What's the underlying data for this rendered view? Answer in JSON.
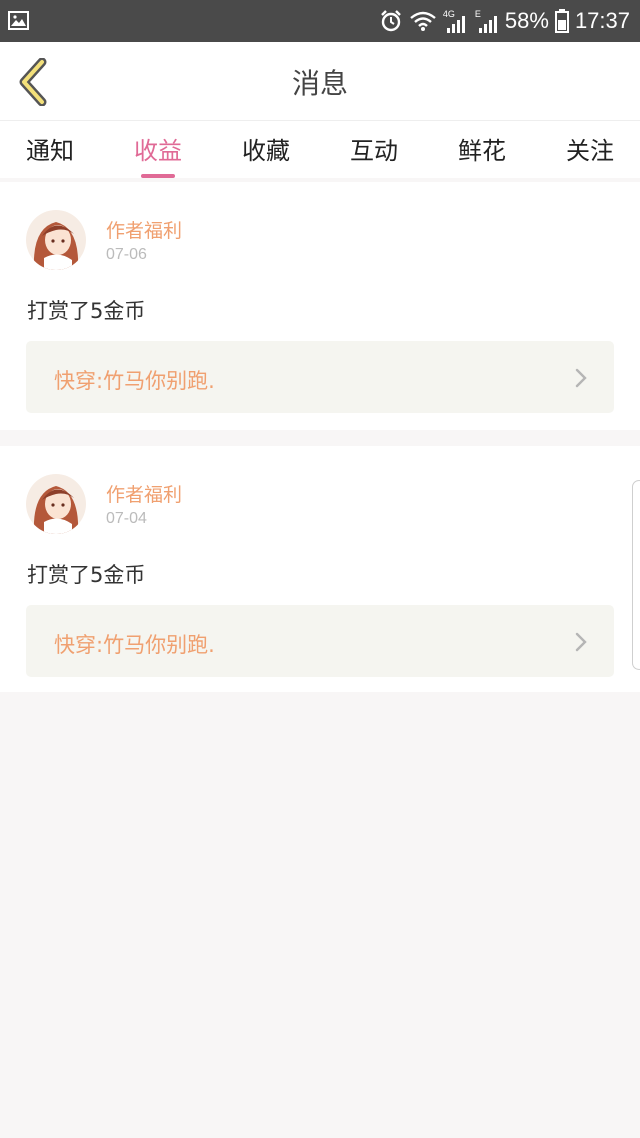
{
  "status_bar": {
    "network_label": "4G",
    "network_label_2": "E",
    "battery": "58%",
    "time": "17:37"
  },
  "header": {
    "title": "消息"
  },
  "tabs": [
    {
      "label": "通知",
      "active": false
    },
    {
      "label": "收益",
      "active": true
    },
    {
      "label": "收藏",
      "active": false
    },
    {
      "label": "互动",
      "active": false
    },
    {
      "label": "鲜花",
      "active": false
    },
    {
      "label": "关注",
      "active": false
    }
  ],
  "messages": [
    {
      "author": "作者福利",
      "date": "07-06",
      "text": "打赏了5金币",
      "book": "快穿:竹马你别跑."
    },
    {
      "author": "作者福利",
      "date": "07-04",
      "text": "打赏了5金币",
      "book": "快穿:竹马你别跑."
    }
  ],
  "colors": {
    "accent": "#e06a96",
    "author": "#f0a070",
    "background": "#f8f6f6"
  }
}
